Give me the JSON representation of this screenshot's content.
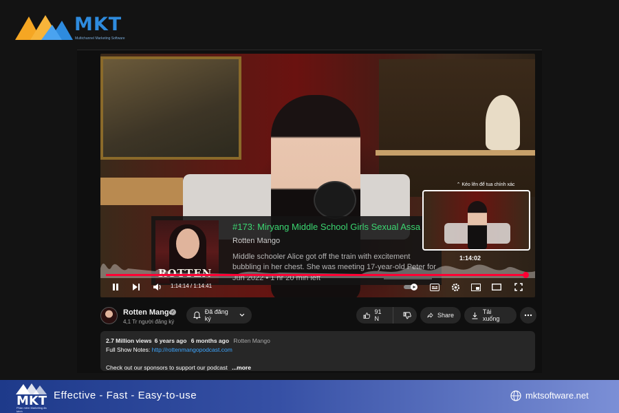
{
  "brand": {
    "name": "MKT",
    "tagline": "Multichannel Marketing Software",
    "footer_slogan": "Effective - Fast - Easy-to-use",
    "footer_site": "mktsoftware.net",
    "footer_sub": "Phần mềm Marketing đa kênh",
    "colors": {
      "primary": "#2e8bde",
      "accent": "#f5a623",
      "footer_start": "#1e3a8a",
      "footer_end": "#7b8fd6"
    }
  },
  "player": {
    "overlay": {
      "title": "#173: Miryang Middle School Girls Sexual Assa",
      "author": "Rotten Mango",
      "description": "Middle schooler Alice got off the train with excitement bubbling in her chest. She was meeting 17-year-old Peter for the first time. She had n",
      "date": "Jun 2022 • 1 hr 20 min left",
      "thumb_word": "ROTTEN"
    },
    "preview_hint": "⌃ Kéo lên để tua chính xác",
    "preview_time": "1:14:02",
    "time_display": "1:14:14 / 1:14:41",
    "progress_fraction": 0.993,
    "icons": [
      "pause-icon",
      "skip-next-icon",
      "volume-icon",
      "autoplay-toggle",
      "subtitles-icon",
      "settings-icon",
      "miniplayer-icon",
      "theater-icon",
      "fullscreen-icon"
    ]
  },
  "channel": {
    "name": "Rotten Mango",
    "subscribers": "4,1 Tr người đăng ký",
    "subscribe_label": "Đã đăng ký",
    "likes": "91 N",
    "share_label": "Share",
    "download_label": "Tải xuống"
  },
  "description": {
    "views": "2.7 Million views",
    "uploaded": "6 years ago",
    "uploaded_rel": "6 months ago",
    "channel": "Rotten Mango",
    "notes_label": "Full Show Notes:",
    "notes_link": "http://rottenmangopodcast.com",
    "sponsors": "Check out our sponsors to support our podcast",
    "more": "...more"
  }
}
